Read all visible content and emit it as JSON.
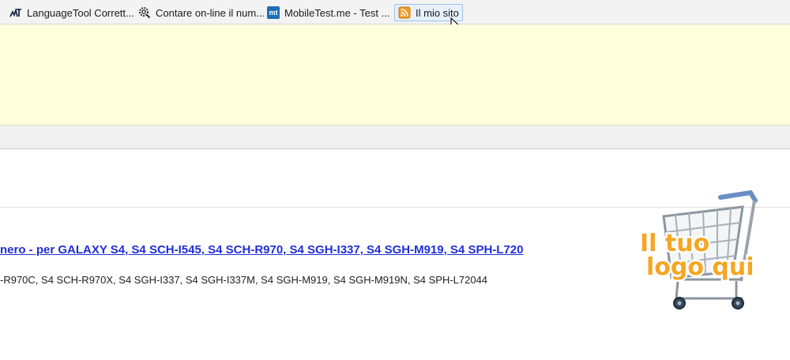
{
  "bookmarks": [
    {
      "label": "LanguageTool Corrett...",
      "icon": "languagetool-icon"
    },
    {
      "label": "Contare on-line il num...",
      "icon": "gear-magnifier-icon"
    },
    {
      "label": "MobileTest.me - Test ...",
      "icon": "mobiletest-icon",
      "icon_text": "mt"
    },
    {
      "label": "Il mio sito",
      "icon": "rss-feed-icon"
    }
  ],
  "product": {
    "title": "nero - per GALAXY S4, S4 SCH-I545, S4 SCH-R970, S4 SGH-I337, S4 SGH-M919, S4 SPH-L720",
    "compatibility": "-R970C, S4 SCH-R970X, S4 SGH-I337, S4 SGH-I337M, S4 SGH-M919, S4 SGH-M919N, S4 SPH-L72044"
  },
  "logo": {
    "line1": "Il tuo",
    "line2": "logo qui"
  },
  "colors": {
    "link": "#1f2fd6",
    "notice_bg": "#ffffdd",
    "logo_fill": "#f5a623"
  }
}
